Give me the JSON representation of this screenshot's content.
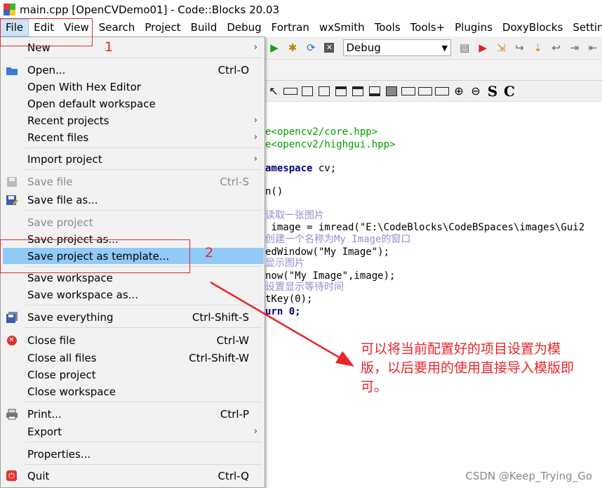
{
  "window": {
    "title": "main.cpp [OpenCVDemo01] - Code::Blocks 20.03"
  },
  "menubar": [
    "File",
    "Edit",
    "View",
    "Search",
    "Project",
    "Build",
    "Debug",
    "Fortran",
    "wxSmith",
    "Tools",
    "Tools+",
    "Plugins",
    "DoxyBlocks",
    "Setting"
  ],
  "toolbar": {
    "build_target": "Debug"
  },
  "code": [
    "e<opencv2/core.hpp>",
    "e<opencv2/highgui.hpp>",
    "amespace cv;",
    "n()",
    "读取一张图片",
    " image = imread(\"E:\\CodeBlocks\\CodeBSpaces\\images\\Gui2",
    "创建一个名称为My Image的窗口",
    "edWindow(\"My Image\");",
    "显示图片",
    "now(\"My Image\",image);",
    "设置显示等待时间",
    "tKey(0);",
    "urn 0;"
  ],
  "file_menu": {
    "new": "New",
    "open": "Open...",
    "open_shortcut": "Ctrl-O",
    "open_hex": "Open With Hex Editor",
    "open_default_ws": "Open default workspace",
    "recent_projects": "Recent projects",
    "recent_files": "Recent files",
    "import_project": "Import project",
    "save_file": "Save file",
    "save_file_shortcut": "Ctrl-S",
    "save_file_as": "Save file as...",
    "save_project": "Save project",
    "save_project_as": "Save project as...",
    "save_project_template": "Save project as template...",
    "save_workspace": "Save workspace",
    "save_workspace_as": "Save workspace as...",
    "save_everything": "Save everything",
    "save_everything_shortcut": "Ctrl-Shift-S",
    "close_file": "Close file",
    "close_file_shortcut": "Ctrl-W",
    "close_all": "Close all files",
    "close_all_shortcut": "Ctrl-Shift-W",
    "close_project": "Close project",
    "close_workspace": "Close workspace",
    "print": "Print...",
    "print_shortcut": "Ctrl-P",
    "export": "Export",
    "properties": "Properties...",
    "quit": "Quit",
    "quit_shortcut": "Ctrl-Q"
  },
  "annotations": {
    "step1": "1",
    "step2": "2",
    "note": "可以将当前配置好的项目设置为模版，以后要用的使用直接导入模版即可。",
    "watermark": "CSDN @Keep_Trying_Go"
  },
  "colors": {
    "highlight": "#91c9f7",
    "annotation_red": "#e8262b"
  }
}
